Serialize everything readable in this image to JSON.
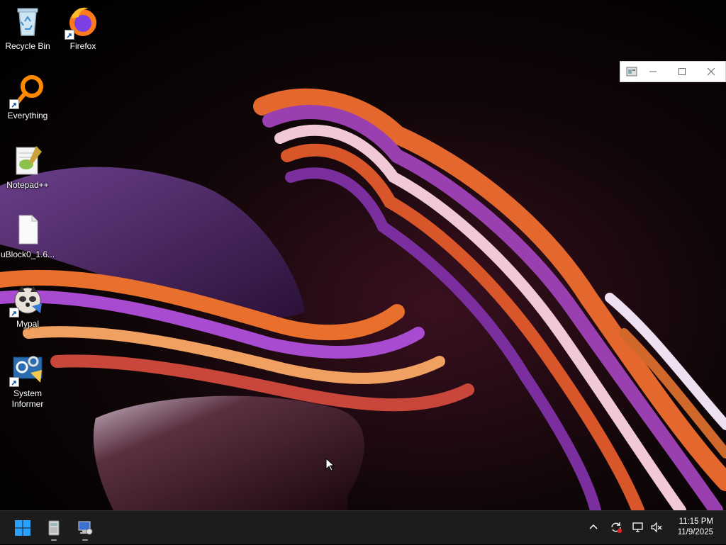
{
  "desktop": {
    "icons": [
      {
        "label": "Recycle Bin",
        "icon": "recycle-bin-icon",
        "shortcut": false
      },
      {
        "label": "Firefox",
        "icon": "firefox-icon",
        "shortcut": true
      },
      {
        "label": "Everything",
        "icon": "everything-search-icon",
        "shortcut": true
      },
      {
        "label": "Notepad++",
        "icon": "notepad-plus-plus-icon",
        "shortcut": false
      },
      {
        "label": "uBlock0_1.6...",
        "icon": "blank-file-icon",
        "shortcut": false
      },
      {
        "label": "Mypal",
        "icon": "mypal-browser-icon",
        "shortcut": true
      },
      {
        "label": "System Informer",
        "icon": "system-informer-icon",
        "shortcut": true
      }
    ]
  },
  "mini_window": {
    "app_icon": "generic-app-icon",
    "controls": [
      "minimize",
      "maximize",
      "close"
    ]
  },
  "taskbar": {
    "start_icon": "windows-start-icon",
    "pinned": [
      {
        "name": "backup-utility",
        "icon": "backup-app-icon"
      },
      {
        "name": "remote-desktop",
        "icon": "remote-desktop-icon"
      }
    ],
    "tray": {
      "icons": [
        "chevron-up-icon",
        "sync-alert-icon",
        "network-icon",
        "volume-muted-icon"
      ]
    },
    "clock": {
      "time": "11:15 PM",
      "date": "11/9/2025"
    }
  },
  "colors": {
    "taskbar_bg": "#1c1c1c",
    "accent_start": "#2aa0ff"
  }
}
